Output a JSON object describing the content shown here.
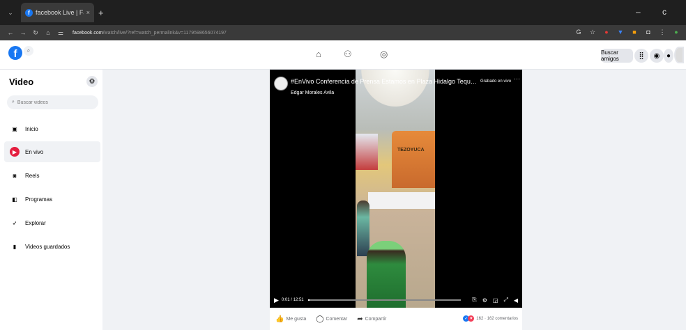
{
  "browser": {
    "tab_title": "facebook Live | Facebook",
    "tab_close": "×",
    "new_tab": "+",
    "window_controls": "–  c",
    "url_host": "facebook.com",
    "url_rest": "/watch/live/?ref=watch_permalink&v=1179598656074197"
  },
  "header": {
    "find_friends": "Buscar amigos"
  },
  "sidebar": {
    "title": "Video",
    "search_placeholder": "Buscar videos",
    "items": [
      {
        "label": "Inicio",
        "icon": "home-video-icon"
      },
      {
        "label": "En vivo",
        "icon": "live-icon"
      },
      {
        "label": "Reels",
        "icon": "reels-icon"
      },
      {
        "label": "Programas",
        "icon": "shows-icon"
      },
      {
        "label": "Explorar",
        "icon": "explore-icon"
      },
      {
        "label": "Videos guardados",
        "icon": "saved-icon"
      }
    ]
  },
  "video": {
    "title": "#EnVivo Conferencia de Prensa Estamos en Plaza Hidalgo Tequisistlán , inform...",
    "badge": "Grabado en vivo",
    "more": "···",
    "author": "Edgar Morales Avila",
    "time": "0:01 / 12:51",
    "progress": 0.01,
    "banner_text": "TEZOYUCA"
  },
  "actions": {
    "like": "Me gusta",
    "comment": "Comentar",
    "share": "Compartir",
    "reactions_count": "162 · 162 comentarios"
  },
  "colors": {
    "accent": "#1877f2",
    "live": "#e41e3f"
  }
}
